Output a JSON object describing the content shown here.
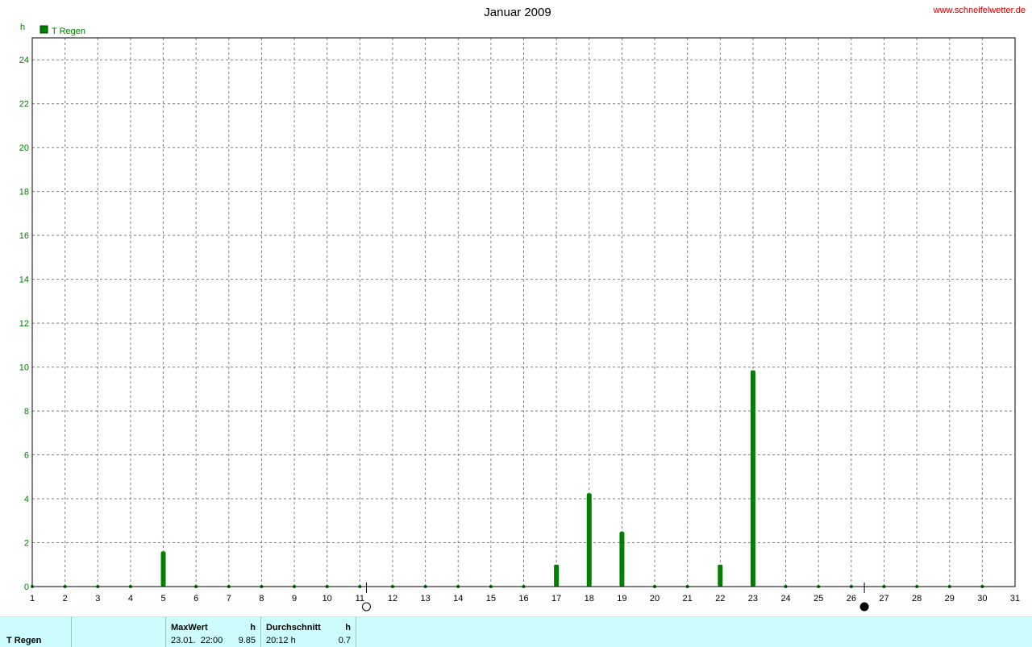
{
  "header": {
    "title": "Januar 2009",
    "site": "www.schneifelwetter.de",
    "y_unit": "h"
  },
  "legend": {
    "label": "T Regen",
    "color": "#008000"
  },
  "chart_data": {
    "type": "bar",
    "title": "Januar 2009",
    "ylabel": "h",
    "ylim": [
      0,
      25
    ],
    "y_ticks": [
      0,
      2,
      4,
      6,
      8,
      10,
      12,
      14,
      16,
      18,
      20,
      22,
      24
    ],
    "xlim": [
      1,
      31
    ],
    "x_ticks": [
      1,
      2,
      3,
      4,
      5,
      6,
      7,
      8,
      9,
      10,
      11,
      12,
      13,
      14,
      15,
      16,
      17,
      18,
      19,
      20,
      21,
      22,
      23,
      24,
      25,
      26,
      27,
      28,
      29,
      30,
      31
    ],
    "grid": true,
    "legend_position": "top-left",
    "series": [
      {
        "name": "T Regen",
        "color": "#008000",
        "points": [
          {
            "x": 1,
            "y": 0
          },
          {
            "x": 2,
            "y": 0
          },
          {
            "x": 3,
            "y": 0
          },
          {
            "x": 4,
            "y": 0
          },
          {
            "x": 5,
            "y": 1.6
          },
          {
            "x": 6,
            "y": 0
          },
          {
            "x": 7,
            "y": 0
          },
          {
            "x": 8,
            "y": 0
          },
          {
            "x": 9,
            "y": 0
          },
          {
            "x": 10,
            "y": 0
          },
          {
            "x": 11,
            "y": 0
          },
          {
            "x": 12,
            "y": 0
          },
          {
            "x": 13,
            "y": 0
          },
          {
            "x": 14,
            "y": 0
          },
          {
            "x": 15,
            "y": 0
          },
          {
            "x": 16,
            "y": 0
          },
          {
            "x": 17,
            "y": 1.0
          },
          {
            "x": 18,
            "y": 4.25
          },
          {
            "x": 19,
            "y": 2.5
          },
          {
            "x": 20,
            "y": 0
          },
          {
            "x": 21,
            "y": 0
          },
          {
            "x": 22,
            "y": 1.0
          },
          {
            "x": 23,
            "y": 9.85
          },
          {
            "x": 24,
            "y": 0
          },
          {
            "x": 25,
            "y": 0
          },
          {
            "x": 26,
            "y": 0
          },
          {
            "x": 27,
            "y": 0
          },
          {
            "x": 28,
            "y": 0
          },
          {
            "x": 29,
            "y": 0
          },
          {
            "x": 30,
            "y": 0
          }
        ]
      }
    ],
    "moon_phases": [
      {
        "x": 11.2,
        "phase": "full"
      },
      {
        "x": 26.4,
        "phase": "new"
      }
    ]
  },
  "footer": {
    "series_label": "T Regen",
    "max_header": "MaxWert",
    "max_unit": "h",
    "max_time": "23.01.  22:00",
    "max_value": "9.85",
    "avg_header": "Durchschnitt",
    "avg_unit": "h",
    "avg_duration": "20:12 h",
    "avg_value": "0.7"
  }
}
